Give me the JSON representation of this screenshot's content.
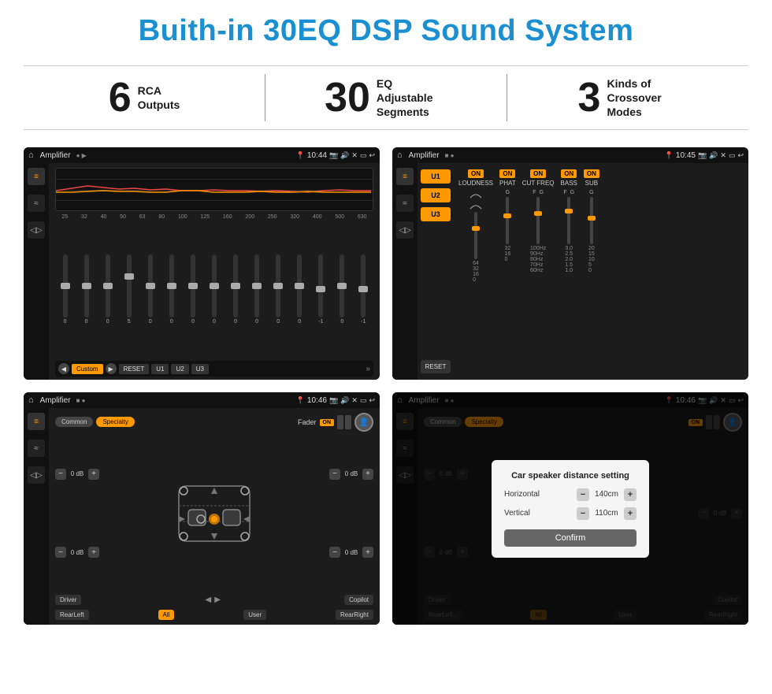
{
  "title": "Buith-in 30EQ DSP Sound System",
  "stats": [
    {
      "number": "6",
      "label": "RCA\nOutputs"
    },
    {
      "number": "30",
      "label": "EQ Adjustable\nSegments"
    },
    {
      "number": "3",
      "label": "Kinds of\nCrossover Modes"
    }
  ],
  "screens": [
    {
      "id": "eq-screen",
      "time": "10:44",
      "title": "Amplifier",
      "frequencies": [
        "25",
        "32",
        "40",
        "50",
        "63",
        "80",
        "100",
        "125",
        "160",
        "200",
        "250",
        "320",
        "400",
        "500",
        "630"
      ],
      "values": [
        "0",
        "0",
        "0",
        "5",
        "0",
        "0",
        "0",
        "0",
        "0",
        "0",
        "0",
        "0",
        "-1",
        "0",
        "-1"
      ],
      "buttons": [
        "Custom",
        "RESET",
        "U1",
        "U2",
        "U3"
      ]
    },
    {
      "id": "crossover-screen",
      "time": "10:45",
      "title": "Amplifier",
      "presets": [
        "U1",
        "U2",
        "U3"
      ],
      "channels": [
        "LOUDNESS",
        "PHAT",
        "CUT FREQ",
        "BASS",
        "SUB"
      ],
      "channelValues": [
        "ON",
        "ON",
        "ON",
        "ON",
        "ON"
      ]
    },
    {
      "id": "fader-screen",
      "time": "10:46",
      "title": "Amplifier",
      "tabs": [
        "Common",
        "Specialty"
      ],
      "faderLabel": "Fader",
      "faderOn": "ON",
      "seats": {
        "driverLabel": "Driver",
        "copilotLabel": "Copilot",
        "rearLeftLabel": "RearLeft",
        "rearRightLabel": "RearRight",
        "allLabel": "All",
        "userLabel": "User"
      },
      "dbValues": [
        "0 dB",
        "0 dB",
        "0 dB",
        "0 dB"
      ]
    },
    {
      "id": "dialog-screen",
      "time": "10:46",
      "title": "Amplifier",
      "tabs": [
        "Common",
        "Specialty"
      ],
      "dialog": {
        "title": "Car speaker distance setting",
        "horizontalLabel": "Horizontal",
        "horizontalValue": "140cm",
        "verticalLabel": "Vertical",
        "verticalValue": "110cm",
        "confirmLabel": "Confirm"
      },
      "seats": {
        "driverLabel": "Driver",
        "copilotLabel": "Copilot",
        "rearLeftLabel": "RearLeft...",
        "rearRightLabel": "RearRight",
        "allLabel": "All",
        "userLabel": "User"
      },
      "dbValues": [
        "0 dB",
        "0 dB"
      ]
    }
  ],
  "accent_color": "#f90000",
  "gold_color": "#f90"
}
